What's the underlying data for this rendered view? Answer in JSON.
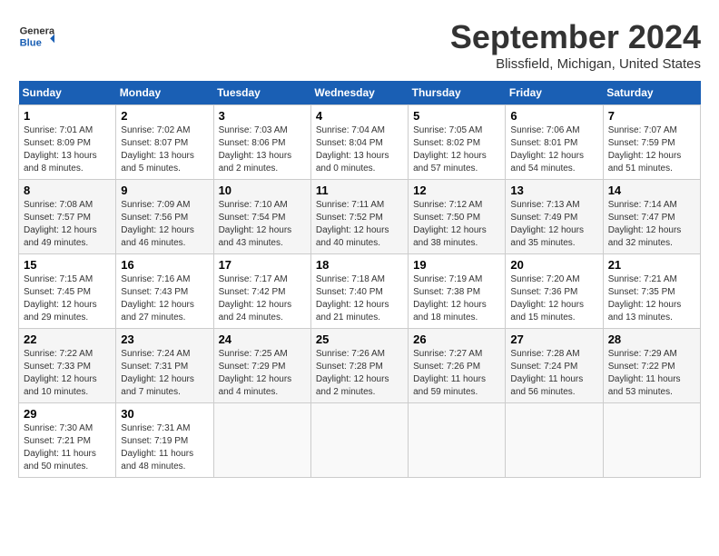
{
  "header": {
    "logo_general": "General",
    "logo_blue": "Blue",
    "month_title": "September 2024",
    "location": "Blissfield, Michigan, United States"
  },
  "days_of_week": [
    "Sunday",
    "Monday",
    "Tuesday",
    "Wednesday",
    "Thursday",
    "Friday",
    "Saturday"
  ],
  "weeks": [
    [
      {
        "day": "1",
        "sunrise": "7:01 AM",
        "sunset": "8:09 PM",
        "daylight": "13 hours and 8 minutes."
      },
      {
        "day": "2",
        "sunrise": "7:02 AM",
        "sunset": "8:07 PM",
        "daylight": "13 hours and 5 minutes."
      },
      {
        "day": "3",
        "sunrise": "7:03 AM",
        "sunset": "8:06 PM",
        "daylight": "13 hours and 2 minutes."
      },
      {
        "day": "4",
        "sunrise": "7:04 AM",
        "sunset": "8:04 PM",
        "daylight": "13 hours and 0 minutes."
      },
      {
        "day": "5",
        "sunrise": "7:05 AM",
        "sunset": "8:02 PM",
        "daylight": "12 hours and 57 minutes."
      },
      {
        "day": "6",
        "sunrise": "7:06 AM",
        "sunset": "8:01 PM",
        "daylight": "12 hours and 54 minutes."
      },
      {
        "day": "7",
        "sunrise": "7:07 AM",
        "sunset": "7:59 PM",
        "daylight": "12 hours and 51 minutes."
      }
    ],
    [
      {
        "day": "8",
        "sunrise": "7:08 AM",
        "sunset": "7:57 PM",
        "daylight": "12 hours and 49 minutes."
      },
      {
        "day": "9",
        "sunrise": "7:09 AM",
        "sunset": "7:56 PM",
        "daylight": "12 hours and 46 minutes."
      },
      {
        "day": "10",
        "sunrise": "7:10 AM",
        "sunset": "7:54 PM",
        "daylight": "12 hours and 43 minutes."
      },
      {
        "day": "11",
        "sunrise": "7:11 AM",
        "sunset": "7:52 PM",
        "daylight": "12 hours and 40 minutes."
      },
      {
        "day": "12",
        "sunrise": "7:12 AM",
        "sunset": "7:50 PM",
        "daylight": "12 hours and 38 minutes."
      },
      {
        "day": "13",
        "sunrise": "7:13 AM",
        "sunset": "7:49 PM",
        "daylight": "12 hours and 35 minutes."
      },
      {
        "day": "14",
        "sunrise": "7:14 AM",
        "sunset": "7:47 PM",
        "daylight": "12 hours and 32 minutes."
      }
    ],
    [
      {
        "day": "15",
        "sunrise": "7:15 AM",
        "sunset": "7:45 PM",
        "daylight": "12 hours and 29 minutes."
      },
      {
        "day": "16",
        "sunrise": "7:16 AM",
        "sunset": "7:43 PM",
        "daylight": "12 hours and 27 minutes."
      },
      {
        "day": "17",
        "sunrise": "7:17 AM",
        "sunset": "7:42 PM",
        "daylight": "12 hours and 24 minutes."
      },
      {
        "day": "18",
        "sunrise": "7:18 AM",
        "sunset": "7:40 PM",
        "daylight": "12 hours and 21 minutes."
      },
      {
        "day": "19",
        "sunrise": "7:19 AM",
        "sunset": "7:38 PM",
        "daylight": "12 hours and 18 minutes."
      },
      {
        "day": "20",
        "sunrise": "7:20 AM",
        "sunset": "7:36 PM",
        "daylight": "12 hours and 15 minutes."
      },
      {
        "day": "21",
        "sunrise": "7:21 AM",
        "sunset": "7:35 PM",
        "daylight": "12 hours and 13 minutes."
      }
    ],
    [
      {
        "day": "22",
        "sunrise": "7:22 AM",
        "sunset": "7:33 PM",
        "daylight": "12 hours and 10 minutes."
      },
      {
        "day": "23",
        "sunrise": "7:24 AM",
        "sunset": "7:31 PM",
        "daylight": "12 hours and 7 minutes."
      },
      {
        "day": "24",
        "sunrise": "7:25 AM",
        "sunset": "7:29 PM",
        "daylight": "12 hours and 4 minutes."
      },
      {
        "day": "25",
        "sunrise": "7:26 AM",
        "sunset": "7:28 PM",
        "daylight": "12 hours and 2 minutes."
      },
      {
        "day": "26",
        "sunrise": "7:27 AM",
        "sunset": "7:26 PM",
        "daylight": "11 hours and 59 minutes."
      },
      {
        "day": "27",
        "sunrise": "7:28 AM",
        "sunset": "7:24 PM",
        "daylight": "11 hours and 56 minutes."
      },
      {
        "day": "28",
        "sunrise": "7:29 AM",
        "sunset": "7:22 PM",
        "daylight": "11 hours and 53 minutes."
      }
    ],
    [
      {
        "day": "29",
        "sunrise": "7:30 AM",
        "sunset": "7:21 PM",
        "daylight": "11 hours and 50 minutes."
      },
      {
        "day": "30",
        "sunrise": "7:31 AM",
        "sunset": "7:19 PM",
        "daylight": "11 hours and 48 minutes."
      },
      null,
      null,
      null,
      null,
      null
    ]
  ]
}
